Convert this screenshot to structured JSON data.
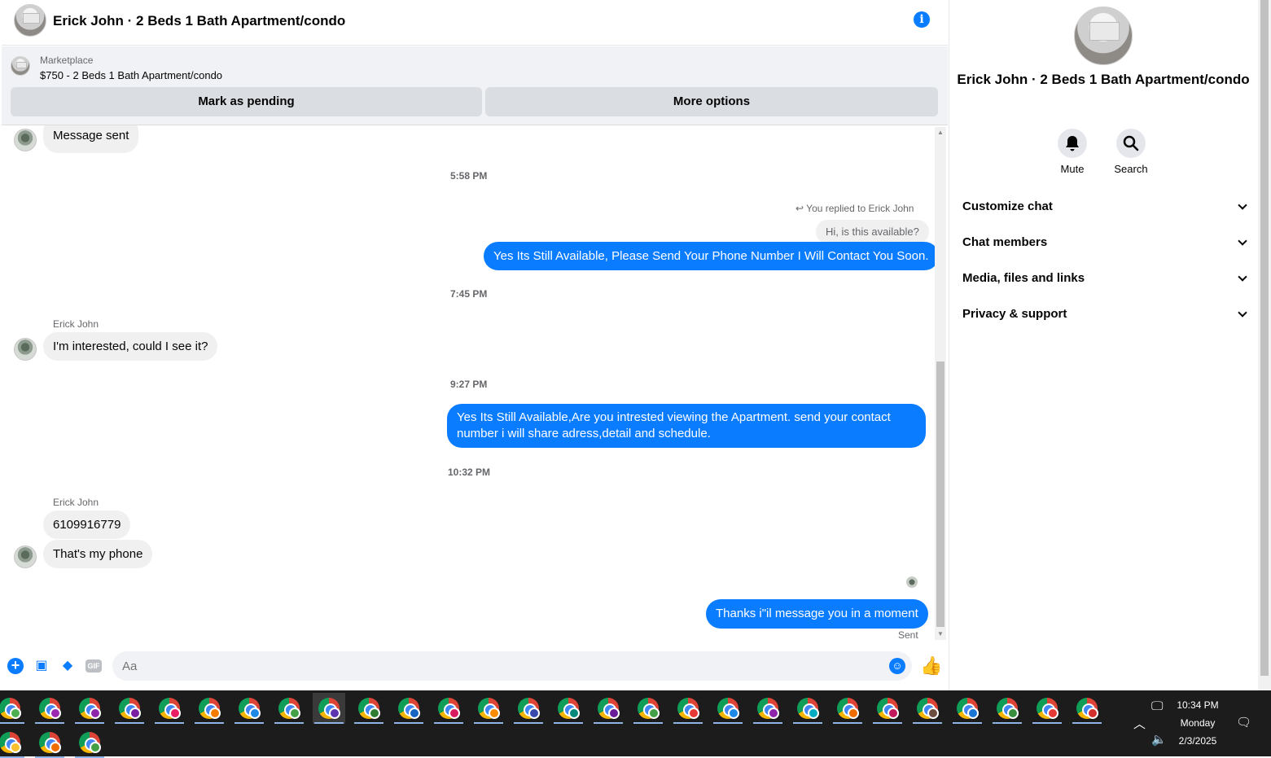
{
  "header": {
    "title": "Erick John · 2 Beds 1 Bath Apartment/condo"
  },
  "marketplace": {
    "label": "Marketplace",
    "item": "$750 - 2 Beds 1 Bath Apartment/condo",
    "mark_pending": "Mark as pending",
    "more_options": "More options"
  },
  "messages": {
    "msg_sent": "Message sent",
    "ts1": "5:58 PM",
    "reply_note": "You replied to Erick John",
    "reply_quote": "Hi, is this available?",
    "out1": "Yes Its Still Available, Please Send Your Phone Number I Will Contact You Soon.",
    "ts2": "7:45 PM",
    "sender1": "Erick John",
    "in1": "I'm interested, could I see it?",
    "ts3": "9:27 PM",
    "out2": "Yes Its Still Available,Are you intrested viewing the Apartment. send your contact number i will share adress,detail and schedule.",
    "ts4": "10:32 PM",
    "sender2": "Erick John",
    "in2": "6109916779",
    "in3": "That's my phone",
    "out3": "Thanks i\"il message you in a moment",
    "sent": "Sent"
  },
  "composer": {
    "placeholder": "Aa",
    "gif": "GIF"
  },
  "sidebar": {
    "name": "Erick John · 2 Beds 1 Bath Apartment/condo",
    "mute": "Mute",
    "search": "Search",
    "sections": [
      "Customize chat",
      "Chat members",
      "Media, files and links",
      "Privacy & support"
    ]
  },
  "taskbar": {
    "time": "10:34 PM",
    "day": "Monday",
    "date": "2/3/2025",
    "profile_colors": [
      "#4caf50",
      "#9c27b0",
      "#8e24aa",
      "#7b1fa2",
      "#e91e63",
      "#f57c00",
      "#1e88e5",
      "#43a047",
      "#5e35b1",
      "#2e7d32",
      "#1565c0",
      "#d81b60",
      "#fb8c00",
      "#3949ab",
      "#00897b",
      "#6a1b9a",
      "#43a047",
      "#e53935",
      "#1e88e5",
      "#8e24aa",
      "#00acc1",
      "#ef6c00",
      "#c2185b",
      "#6d4c41",
      "#1976d2",
      "#388e3c",
      "#e53935",
      "#d32f2f",
      "#fbc02d",
      "#ef6c00",
      "#43a047"
    ]
  }
}
